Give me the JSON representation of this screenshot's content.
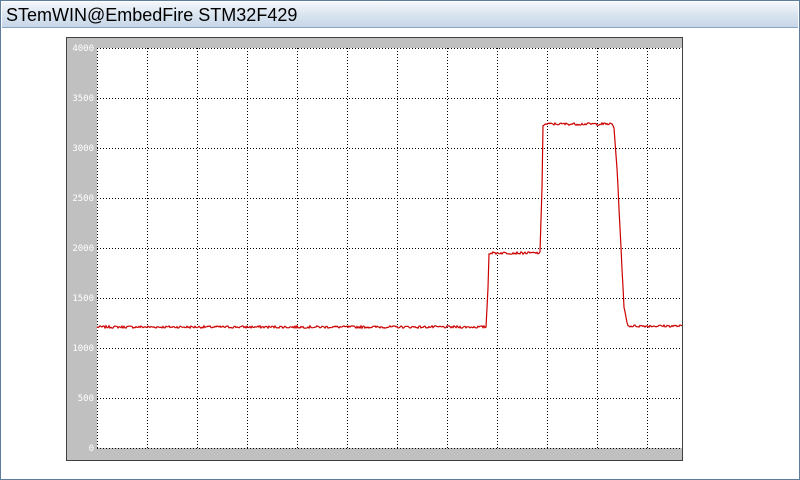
{
  "window": {
    "title": "STemWIN@EmbedFire STM32F429"
  },
  "colors": {
    "plot_background": "#ffffff",
    "frame_background": "#c0c0c0",
    "grid": "#000000",
    "trace": "#cc0000",
    "titlebar_top": "#f4f7fb",
    "titlebar_bottom": "#c7d6e8"
  },
  "chart_data": {
    "type": "line",
    "title": "",
    "xlabel": "",
    "ylabel": "",
    "ylim": [
      0,
      4000
    ],
    "y_ticks": [
      "0",
      "500",
      "1000",
      "1500",
      "2000",
      "2500",
      "3000",
      "3500",
      "4000"
    ],
    "grid": true,
    "grid_style": "dotted",
    "x_grid_divisions": 12,
    "xlim": [
      0,
      600
    ],
    "series": [
      {
        "values_x": [
          0,
          389,
          391,
          392,
          440,
          443,
          445,
          446,
          450,
          515,
          517,
          520,
          524,
          527,
          531,
          600
        ],
        "values_y": [
          1210,
          1210,
          1600,
          1950,
          1950,
          1950,
          2600,
          3230,
          3240,
          3240,
          3200,
          2800,
          2000,
          1400,
          1220,
          1220
        ]
      }
    ]
  }
}
